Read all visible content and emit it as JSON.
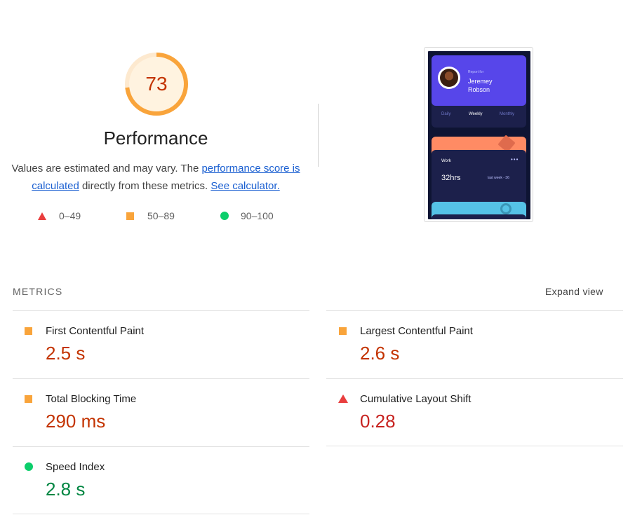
{
  "score": {
    "value": "73",
    "fraction": 0.73,
    "color": "#f9a43b",
    "text_color": "#c33300"
  },
  "title": "Performance",
  "description": {
    "part1": "Values are estimated and may vary. The ",
    "link1": "performance score is calculated",
    "part2": " directly from these metrics. ",
    "link2": "See calculator."
  },
  "legend": [
    {
      "range": "0–49",
      "icon": "triangle-icon",
      "color": "#e93e3e"
    },
    {
      "range": "50–89",
      "icon": "square-icon",
      "color": "#f9a43b"
    },
    {
      "range": "90–100",
      "icon": "circle-icon",
      "color": "#0cce6b"
    }
  ],
  "screenshot": {
    "report_for": "Report for",
    "name_line1": "Jeremey",
    "name_line2": "Robson",
    "tabs": [
      "Daily",
      "Weekly",
      "Monthly"
    ],
    "active_tab": "Weekly",
    "work_label": "Work",
    "work_dots": "•••",
    "work_hours": "32hrs",
    "work_last": "last week - 36"
  },
  "metrics_section": {
    "heading": "METRICS",
    "expand_label": "Expand view"
  },
  "metrics": [
    {
      "label": "First Contentful Paint",
      "value": "2.5 s",
      "status": "average"
    },
    {
      "label": "Largest Contentful Paint",
      "value": "2.6 s",
      "status": "average"
    },
    {
      "label": "Total Blocking Time",
      "value": "290 ms",
      "status": "average"
    },
    {
      "label": "Cumulative Layout Shift",
      "value": "0.28",
      "status": "fail"
    },
    {
      "label": "Speed Index",
      "value": "2.8 s",
      "status": "pass"
    }
  ]
}
